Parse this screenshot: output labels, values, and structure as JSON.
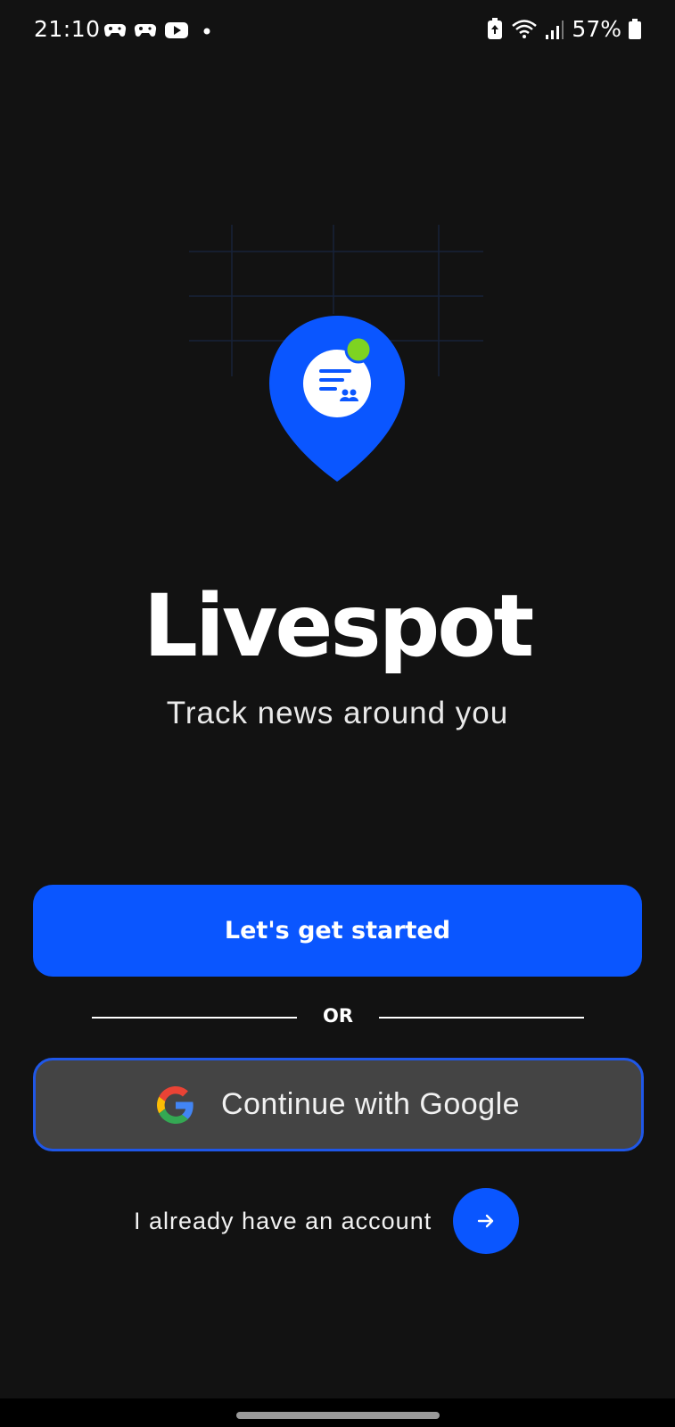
{
  "status_bar": {
    "time": "21:10",
    "battery": "57%",
    "left_icons": [
      "game-controller-icon",
      "game-controller-icon",
      "youtube-icon",
      "dot-icon"
    ],
    "right_icons": [
      "battery-saver-icon",
      "wifi-icon",
      "signal-icon",
      "battery-icon"
    ]
  },
  "app": {
    "title": "Livespot",
    "subtitle": "Track news around you",
    "brand_color": "#0a56ff",
    "status_dot_color": "#7ed321"
  },
  "actions": {
    "get_started_label": "Let's get started",
    "or_label": "OR",
    "google_label": "Continue with Google",
    "account_label": "I already have an account"
  },
  "icons": {
    "logo": "map-pin-news-icon",
    "google": "google-icon",
    "arrow": "arrow-right-icon"
  }
}
